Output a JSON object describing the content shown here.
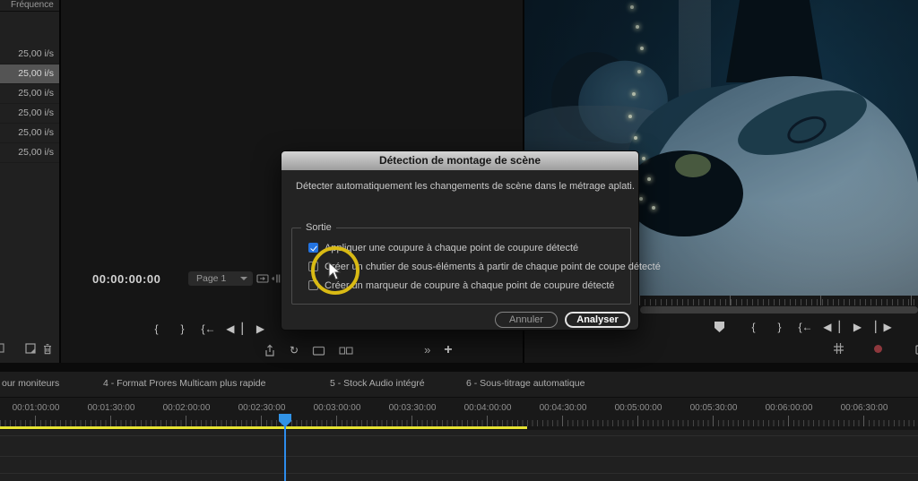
{
  "colors": {
    "accent_blue": "#2d8ceb",
    "workarea_yellow": "#e6e332",
    "highlight_yellow": "#d9ba14",
    "record_red": "#8e383d",
    "checkbox_blue": "#2373e0"
  },
  "bin_panel": {
    "column_header": "Fréquence",
    "rows": [
      "25,00 i/s",
      "25,00 i/s",
      "25,00 i/s",
      "25,00 i/s",
      "25,00 i/s",
      "25,00 i/s"
    ],
    "selected_row_index": 1,
    "tools": [
      "new-item",
      "trash"
    ]
  },
  "source_monitor": {
    "timecode": "00:00:00:00",
    "page_selector": "Page 1",
    "transport": [
      "mark-in",
      "mark-out",
      "go-to-in",
      "step-back",
      "play"
    ],
    "tools": [
      "export",
      "lift",
      "monitor",
      "multicam",
      "more",
      "add"
    ]
  },
  "program_monitor": {
    "transport": [
      "marker",
      "mark-in",
      "mark-out",
      "go-to-in",
      "step-back",
      "play",
      "step-forward"
    ],
    "tools": [
      "grid",
      "record",
      "camera"
    ]
  },
  "dialog": {
    "title": "Détection de montage de scène",
    "description": "Détecter automatiquement les changements de scène dans le métrage aplati.",
    "group_label": "Sortie",
    "options": [
      {
        "label": "Appliquer une coupure à chaque point de coupure détecté",
        "checked": true
      },
      {
        "label": "Créer un chutier de sous-éléments à partir de chaque point de coupe détecté",
        "checked": false
      },
      {
        "label": "Créer un marqueur de coupure à chaque point de coupure détecté",
        "checked": false
      }
    ],
    "cancel_label": "Annuler",
    "confirm_label": "Analyser"
  },
  "timeline": {
    "tabs": [
      "our moniteurs",
      "4 - Format Prores Multicam plus rapide",
      "5 - Stock Audio intégré",
      "6 - Sous-titrage automatique"
    ],
    "ruler_labels": [
      "00:01:00:00",
      "00:01:30:00",
      "00:02:00:00",
      "00:02:30:00",
      "00:03:00:00",
      "00:03:30:00",
      "00:04:00:00",
      "00:04:30:00",
      "00:05:00:00",
      "00:05:30:00",
      "00:06:00:00",
      "00:06:30:00"
    ]
  }
}
